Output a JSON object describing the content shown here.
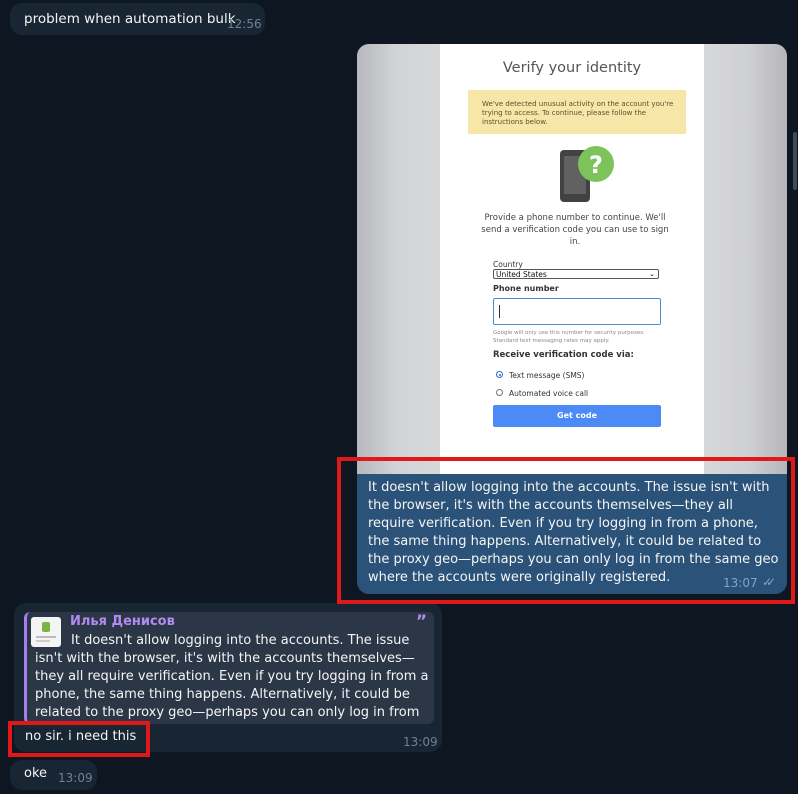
{
  "messages": {
    "m1": {
      "text": "problem when automation bulk",
      "time": "12:56"
    },
    "m2": {
      "screenshot": {
        "title": "Verify your identity",
        "warning": "We've detected unusual activity on the account you're trying to access. To continue, please follow the instructions below.",
        "description": "Provide a phone number to continue. We'll send a verification code you can use to sign in.",
        "country_label": "Country",
        "country_value": "United States",
        "phone_label": "Phone number",
        "phone_note": "Google will only use this number for security purposes. Standard text messaging rates may apply.",
        "receive_label": "Receive verification code via:",
        "option_sms": "Text message (SMS)",
        "option_voice": "Automated voice call",
        "button": "Get code"
      },
      "text": "It doesn't allow logging into the accounts. The issue isn't with the browser, it's with the accounts themselves—they all require verification. Even if you try logging in from a phone, the same thing happens. Alternatively, it could be related to the proxy geo—perhaps you can only log in from the same geo where the accounts were originally registered.",
      "time": "13:07"
    },
    "m3": {
      "reply_author": "Илья Денисов",
      "reply_text": "It doesn't allow logging into the accounts. The issue isn't with the browser, it's with the accounts themselves—they all require verification. Even if you try logging in from a phone, the same thing happens. Alternatively, it could be related to the proxy geo—perhaps you can only log in from the same geo whe...",
      "text": "no sir. i need this",
      "time": "13:09"
    },
    "m4": {
      "text": "oke",
      "time": "13:09"
    }
  }
}
